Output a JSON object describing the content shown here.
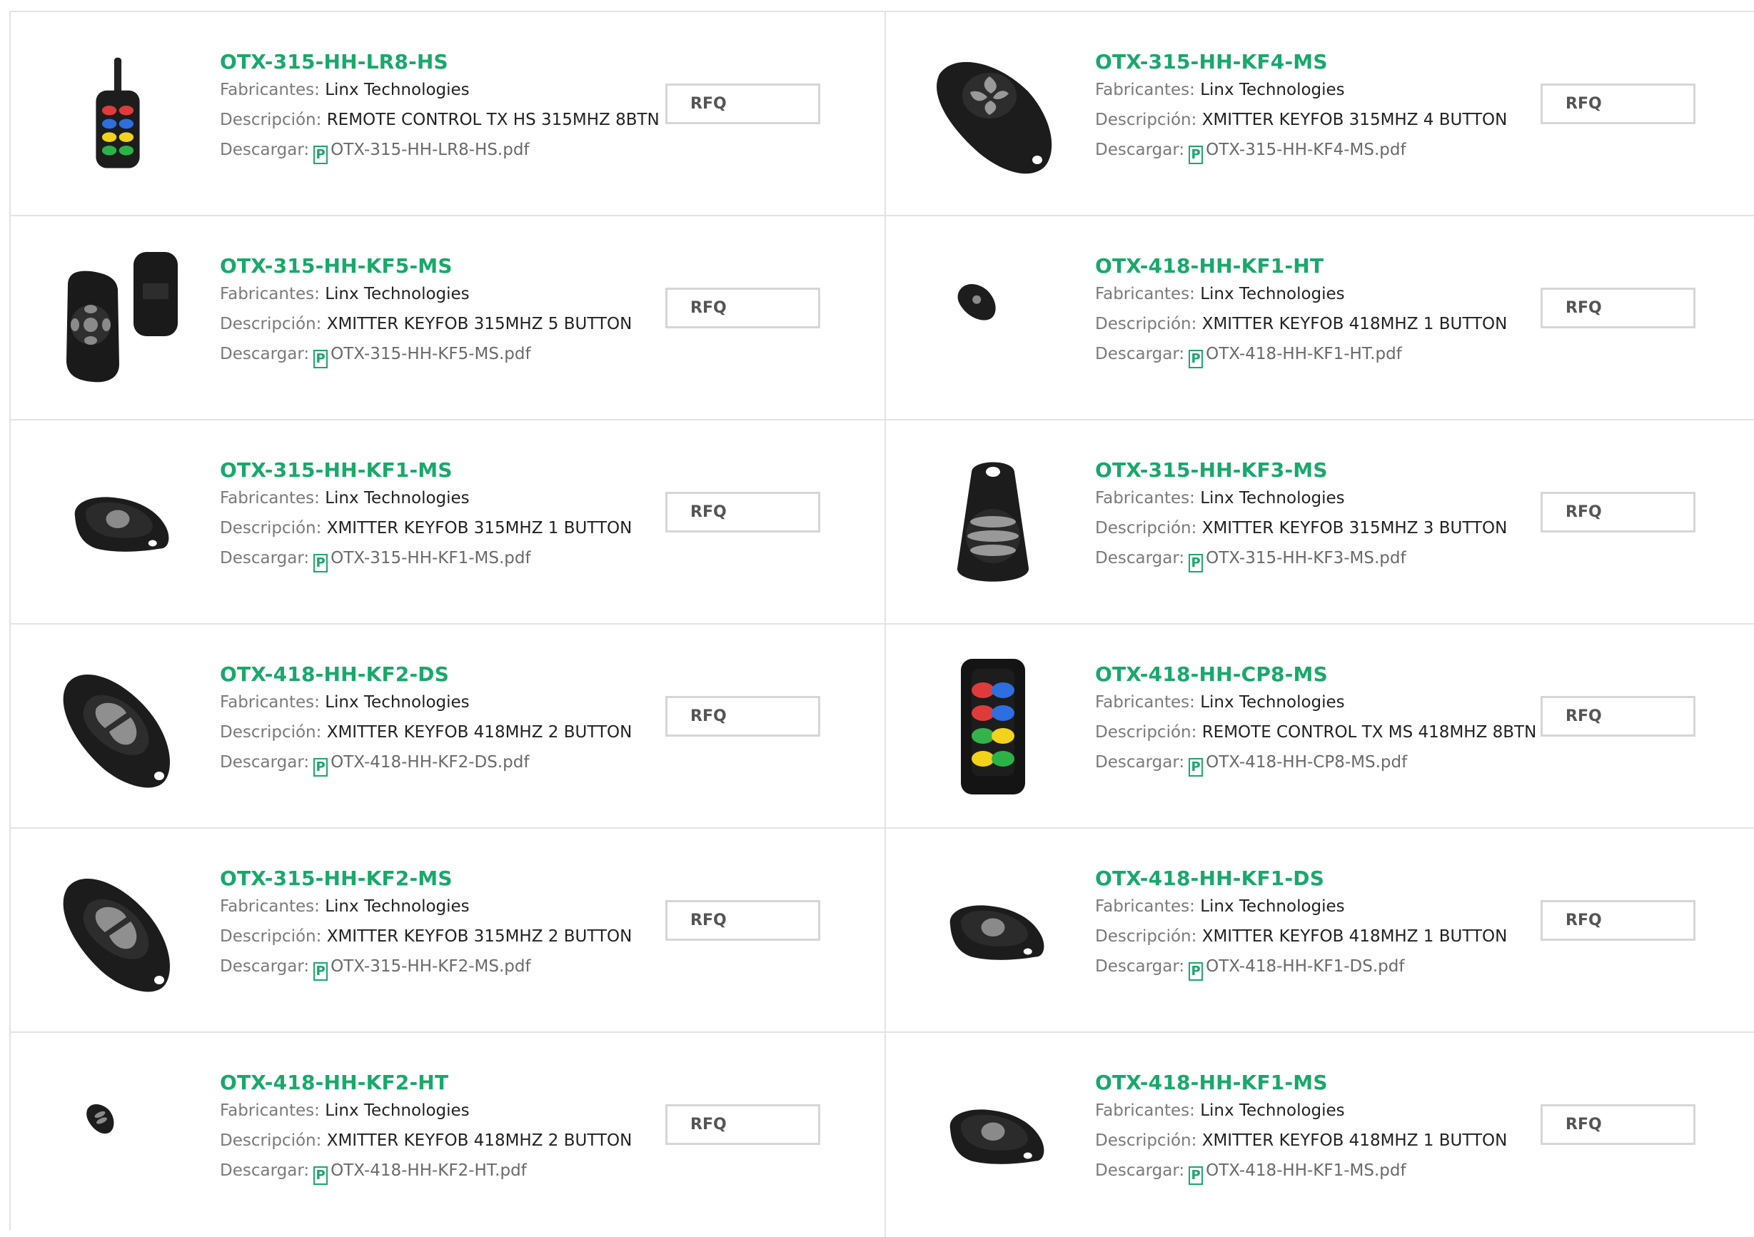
{
  "labels": {
    "manufacturer": "Fabricantes:",
    "description": "Descripción:",
    "download": "Descargar:",
    "rfq": "RFQ",
    "pdf_glyph": "P"
  },
  "colors": {
    "accent": "#1aa86b",
    "border": "#e3e3e3",
    "button_border": "#d6d6d6"
  },
  "products": [
    {
      "part": "OTX-315-HH-LR8-HS",
      "manufacturer": "Linx Technologies",
      "description": "REMOTE CONTROL TX HS 315MHZ 8BTN",
      "file": "OTX-315-HH-LR8-HS.pdf",
      "image": "antenna-remote-8-button-image"
    },
    {
      "part": "OTX-315-HH-KF4-MS",
      "manufacturer": "Linx Technologies",
      "description": "XMITTER KEYFOB 315MHZ 4 BUTTON",
      "file": "OTX-315-HH-KF4-MS.pdf",
      "image": "keyfob-4-button-image"
    },
    {
      "part": "OTX-315-HH-KF5-MS",
      "manufacturer": "Linx Technologies",
      "description": "XMITTER KEYFOB 315MHZ 5 BUTTON",
      "file": "OTX-315-HH-KF5-MS.pdf",
      "image": "keyfob-5-button-image"
    },
    {
      "part": "OTX-418-HH-KF1-HT",
      "manufacturer": "Linx Technologies",
      "description": "XMITTER KEYFOB 418MHZ 1 BUTTON",
      "file": "OTX-418-HH-KF1-HT.pdf",
      "image": "small-keyfob-1-button-image"
    },
    {
      "part": "OTX-315-HH-KF1-MS",
      "manufacturer": "Linx Technologies",
      "description": "XMITTER KEYFOB 315MHZ 1 BUTTON",
      "file": "OTX-315-HH-KF1-MS.pdf",
      "image": "keyfob-1-button-image"
    },
    {
      "part": "OTX-315-HH-KF3-MS",
      "manufacturer": "Linx Technologies",
      "description": "XMITTER KEYFOB 315MHZ 3 BUTTON",
      "file": "OTX-315-HH-KF3-MS.pdf",
      "image": "keyfob-3-button-image"
    },
    {
      "part": "OTX-418-HH-KF2-DS",
      "manufacturer": "Linx Technologies",
      "description": "XMITTER KEYFOB 418MHZ 2 BUTTON",
      "file": "OTX-418-HH-KF2-DS.pdf",
      "image": "keyfob-2-button-image"
    },
    {
      "part": "OTX-418-HH-CP8-MS",
      "manufacturer": "Linx Technologies",
      "description": "REMOTE CONTROL TX MS 418MHZ 8BTN",
      "file": "OTX-418-HH-CP8-MS.pdf",
      "image": "remote-8-button-image"
    },
    {
      "part": "OTX-315-HH-KF2-MS",
      "manufacturer": "Linx Technologies",
      "description": "XMITTER KEYFOB 315MHZ 2 BUTTON",
      "file": "OTX-315-HH-KF2-MS.pdf",
      "image": "keyfob-2-button-image"
    },
    {
      "part": "OTX-418-HH-KF1-DS",
      "manufacturer": "Linx Technologies",
      "description": "XMITTER KEYFOB 418MHZ 1 BUTTON",
      "file": "OTX-418-HH-KF1-DS.pdf",
      "image": "keyfob-1-button-image"
    },
    {
      "part": "OTX-418-HH-KF2-HT",
      "manufacturer": "Linx Technologies",
      "description": "XMITTER KEYFOB 418MHZ 2 BUTTON",
      "file": "OTX-418-HH-KF2-HT.pdf",
      "image": "small-keyfob-2-button-image"
    },
    {
      "part": "OTX-418-HH-KF1-MS",
      "manufacturer": "Linx Technologies",
      "description": "XMITTER KEYFOB 418MHZ 1 BUTTON",
      "file": "OTX-418-HH-KF1-MS.pdf",
      "image": "keyfob-1-button-image"
    }
  ]
}
